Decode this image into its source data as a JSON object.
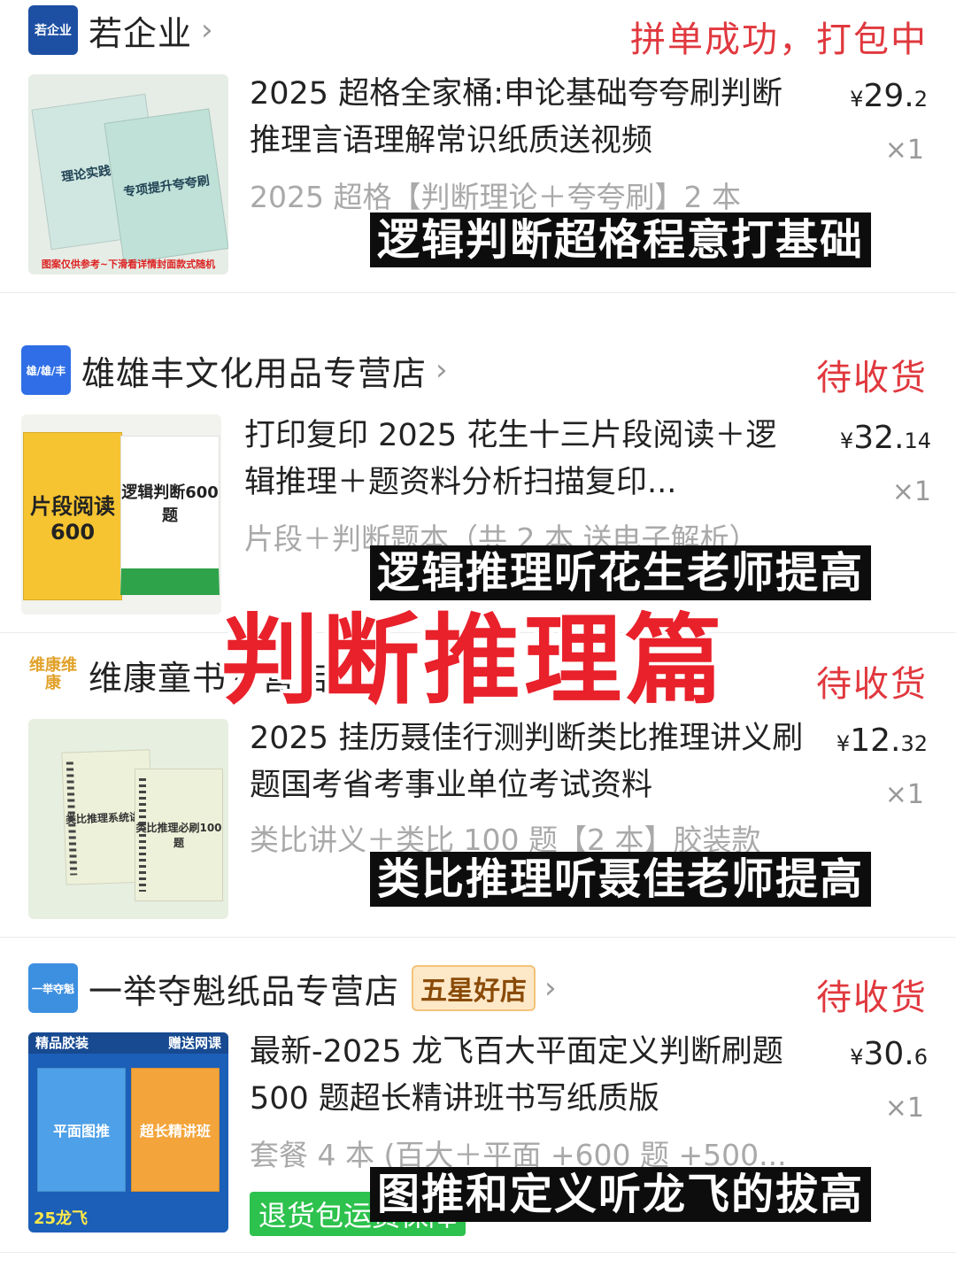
{
  "orders": [
    {
      "shop": {
        "logo_text": "若企业",
        "name": "若企业",
        "logo_color": "#1d4fa3"
      },
      "status": "拼单成功，打包中",
      "title": "2025 超格全家桶:申论基础夸夸刷判断推理言语理解常识纸质送视频",
      "variant": "2025 超格【判断理论＋夸夸刷】2 本",
      "price_symbol": "¥",
      "price_int": "29.",
      "price_dec": "2",
      "qty": "×1",
      "caption": "逻辑判断超格程意打基础",
      "thumb": {
        "book1": "理论实践讲义",
        "book2": "专项提升夸夸刷",
        "footer": "图案仅供参考~下滑看详情封面款式随机"
      }
    },
    {
      "shop": {
        "logo_text": "雄/雄/丰",
        "name": "雄雄丰文化用品专营店",
        "logo_color": "#2f6ee6"
      },
      "status": "待收货",
      "title": "打印复印 2025 花生十三片段阅读＋逻辑推理＋题资料分析扫描复印...",
      "variant": "片段＋判断题本（共 2 本 送电子解析）",
      "price_symbol": "¥",
      "price_int": "32.",
      "price_dec": "14",
      "qty": "×1",
      "caption": "逻辑推理听花生老师提高",
      "thumb": {
        "book1": "片段阅读600",
        "book2": "逻辑判断600题"
      }
    },
    {
      "shop": {
        "logo_text": "维康维康",
        "name": "维康童书专营店",
        "logo_color": "#e1a22a"
      },
      "status": "待收货",
      "title": "2025 挂历聂佳行测判断类比推理讲义刷题国考省考事业单位考试资料",
      "variant": "类比讲义＋类比 100 题【2 本】胶装款",
      "price_symbol": "¥",
      "price_int": "12.",
      "price_dec": "32",
      "qty": "×1",
      "caption": "类比推理听聂佳老师提高",
      "thumb": {
        "book1": "类比推理系统讲义",
        "book2": "类比推理必刷100题"
      }
    },
    {
      "shop": {
        "logo_text": "一举夺魁",
        "name": "一举夺魁纸品专营店",
        "logo_color": "#3d8fe0"
      },
      "badge": "五星好店",
      "status": "待收货",
      "title": "最新-2025 龙飞百大平面定义判断刷题 500 题超长精讲班书写纸质版",
      "variant": "套餐 4 本 (百大＋平面 +600 题 +500...",
      "price_symbol": "¥",
      "price_int": "30.",
      "price_dec": "6",
      "qty": "×1",
      "caption": "图推和定义听龙飞的拔高",
      "refund": "退货包运费保障",
      "thumb": {
        "tag_left": "精品胶装",
        "tag_right": "赠送网课",
        "book1": "平面图推",
        "book2": "超长精讲班",
        "footer": "25龙飞"
      }
    }
  ],
  "overlay_title": "判断推理篇"
}
